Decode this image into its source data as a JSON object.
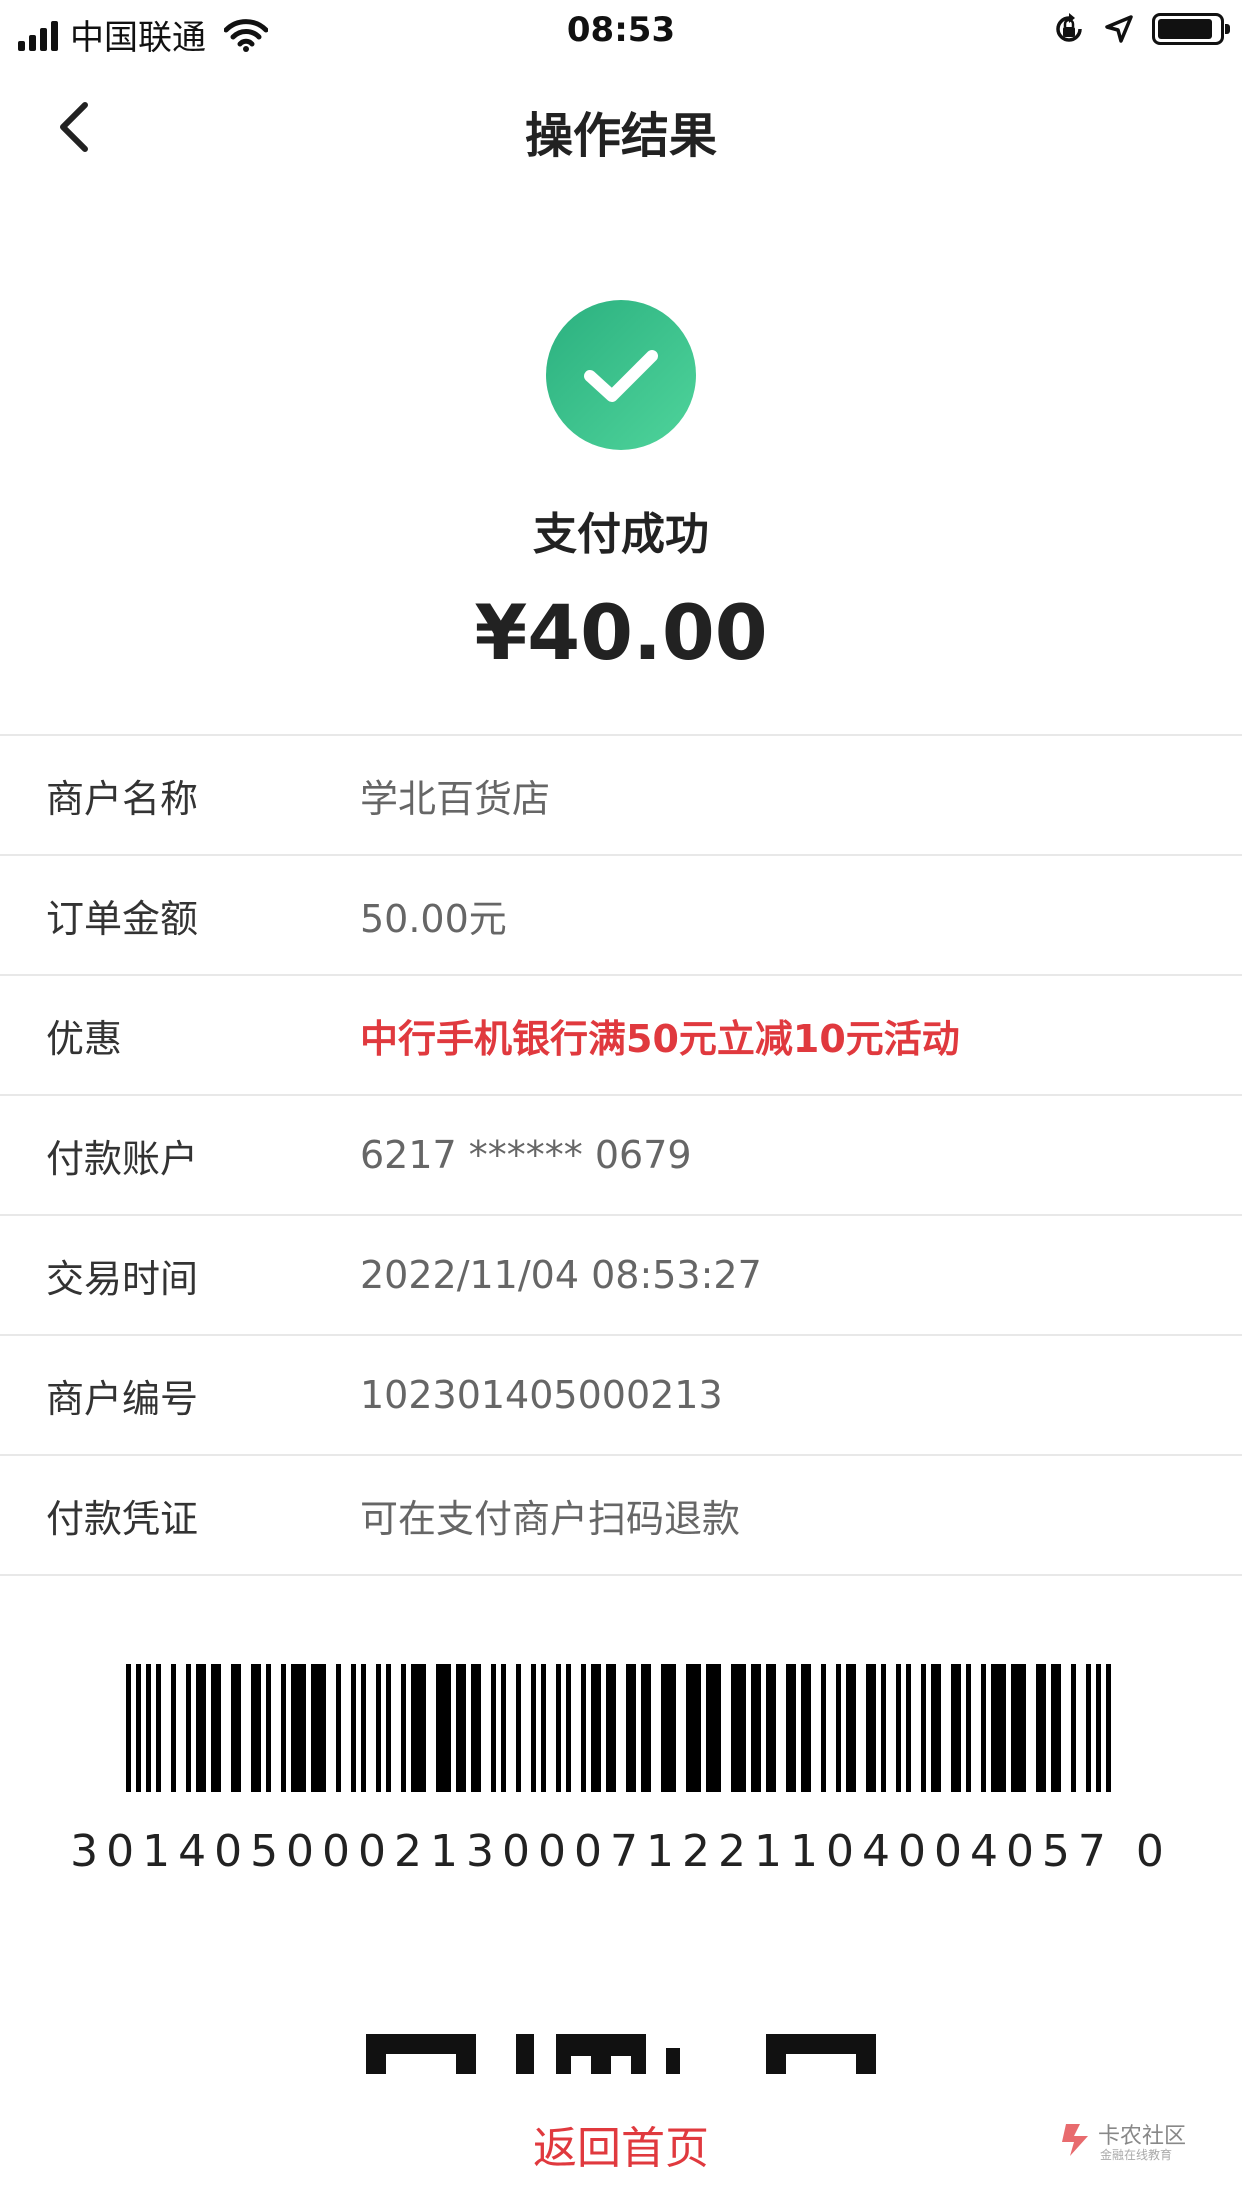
{
  "status_bar": {
    "carrier": "中国联通",
    "time": "08:53",
    "battery_level": 0.9
  },
  "nav": {
    "title": "操作结果"
  },
  "result": {
    "status_text": "支付成功",
    "amount": "¥40.00",
    "accent_color": "#2fbf8a"
  },
  "details": [
    {
      "label": "商户名称",
      "value": "学北百货店",
      "highlight": false
    },
    {
      "label": "订单金额",
      "value": "50.00元",
      "highlight": false
    },
    {
      "label": "优惠",
      "value": "中行手机银行满50元立减10元活动",
      "highlight": true
    },
    {
      "label": "付款账户",
      "value": "6217 ****** 0679",
      "highlight": false
    },
    {
      "label": "交易时间",
      "value": "2022/11/04 08:53:27",
      "highlight": false
    },
    {
      "label": "商户编号",
      "value": "102301405000213",
      "highlight": false
    },
    {
      "label": "付款凭证",
      "value": "可在支付商户扫码退款",
      "highlight": false
    }
  ],
  "barcode": {
    "number": "30140500021300071221104004057 0"
  },
  "footer": {
    "home_label": "返回首页",
    "watermark": "卡农社区",
    "watermark_sub": "金融在线教育"
  },
  "colors": {
    "highlight": "#e0393e",
    "divider": "#e8e8e8"
  }
}
